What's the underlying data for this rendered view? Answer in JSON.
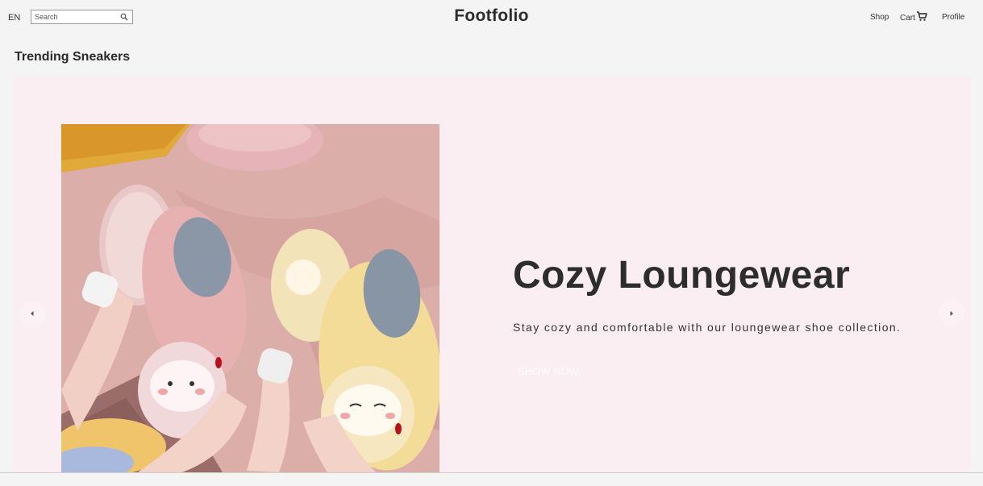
{
  "header": {
    "language": "EN",
    "search": {
      "placeholder": "Search",
      "value": ""
    },
    "logo": "Footfolio",
    "nav": {
      "shop": "Shop",
      "cart": "Cart",
      "profile": "Profile"
    }
  },
  "section": {
    "title": "Trending Sneakers"
  },
  "carousel": {
    "slide": {
      "heading": "Cozy Loungewear",
      "description": "Stay cozy and comfortable with our loungewear shoe collection.",
      "cta": "SHOW NOW",
      "image": "fluffy-slippers-photo"
    },
    "prev_icon": "chevron-left-icon",
    "next_icon": "chevron-right-icon"
  },
  "colors": {
    "page_bg": "#f4f4f4",
    "slide_bg": "#fbeef2",
    "text_dark": "#2d2d2d"
  },
  "icons": {
    "search": "search-icon",
    "cart": "cart-icon"
  }
}
